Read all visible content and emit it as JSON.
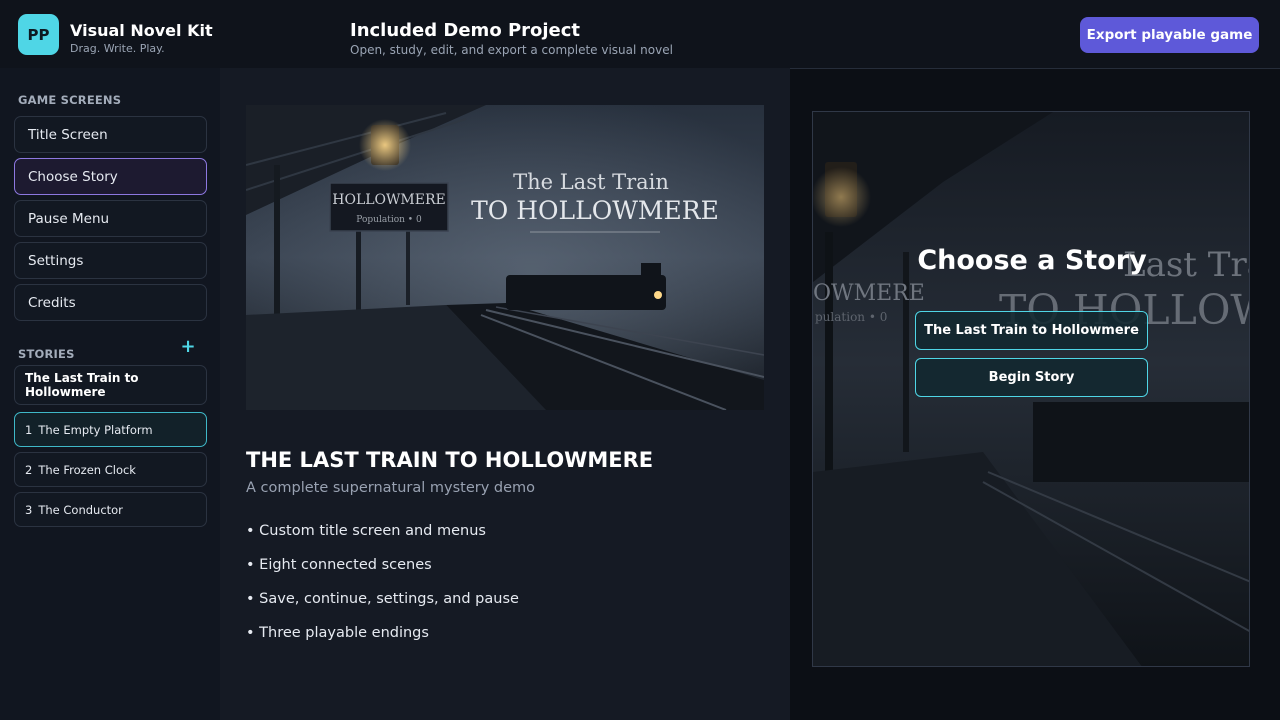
{
  "header": {
    "logo_text": "PP",
    "app_title": "Visual Novel Kit",
    "app_subtitle": "Drag. Write. Play.",
    "project_title": "Included Demo Project",
    "project_subtitle": "Open, study, edit, and export a complete visual novel",
    "export_label": "Export playable game"
  },
  "sidebar": {
    "screens_label": "GAME SCREENS",
    "screens": [
      {
        "label": "Title Screen"
      },
      {
        "label": "Choose Story",
        "active": true
      },
      {
        "label": "Pause Menu"
      },
      {
        "label": "Settings"
      },
      {
        "label": "Credits"
      }
    ],
    "stories_label": "STORIES",
    "add_label": "+",
    "story_title": "The Last Train to Hollowmere",
    "scenes": [
      {
        "num": "1",
        "label": "The Empty Platform",
        "active": true
      },
      {
        "num": "2",
        "label": "The Frozen Clock"
      },
      {
        "num": "3",
        "label": "The Conductor"
      }
    ]
  },
  "main": {
    "hero": {
      "sign_name": "HOLLOWMERE",
      "sign_sub": "Population • 0",
      "title_line1": "The Last Train",
      "title_line2": "TO HOLLOWMERE"
    },
    "heading": "THE LAST TRAIN TO HOLLOWMERE",
    "subheading": "A complete supernatural mystery demo",
    "features": [
      "• Custom title screen and menus",
      "• Eight connected scenes",
      "• Save, continue, settings, and pause",
      "• Three playable endings"
    ]
  },
  "preview": {
    "bg_sign_name": "OWMERE",
    "bg_sign_sub": "pulation • 0",
    "bg_title_line1": "Last Tra",
    "bg_title_line2": "TO HOLLOW",
    "title": "Choose a Story",
    "buttons": [
      "The Last Train to Hollowmere",
      "Begin Story"
    ]
  },
  "colors": {
    "accent": "#4fd6e6",
    "export_button": "#5e59d9",
    "active_screen_border": "#8d78e0"
  }
}
